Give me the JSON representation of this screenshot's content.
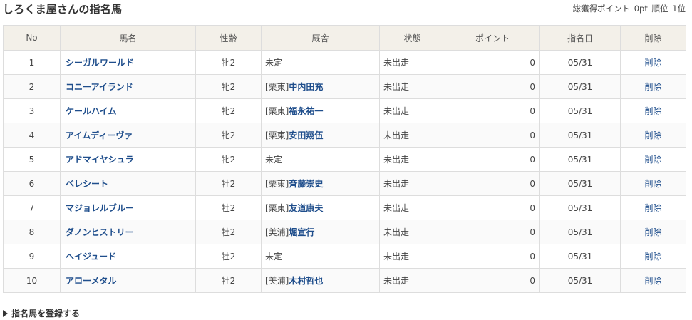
{
  "header": {
    "title": "しろくま屋さんの指名馬",
    "total_points_label": "総獲得ポイント",
    "total_points_value": "0pt",
    "rank_label": "順位",
    "rank_value": "1位"
  },
  "table": {
    "columns": [
      "No",
      "馬名",
      "性齢",
      "厩舎",
      "状態",
      "ポイント",
      "指名日",
      "削除"
    ],
    "rows": [
      {
        "no": "1",
        "name": "シーガルワールド",
        "sex_age": "牝2",
        "stable_prefix": "未定",
        "trainer": "",
        "status": "未出走",
        "points": "0",
        "date": "05/31",
        "delete": "削除"
      },
      {
        "no": "2",
        "name": "コニーアイランド",
        "sex_age": "牝2",
        "stable_prefix": "[栗東]",
        "trainer": "中内田充",
        "status": "未出走",
        "points": "0",
        "date": "05/31",
        "delete": "削除"
      },
      {
        "no": "3",
        "name": "ケールハイム",
        "sex_age": "牝2",
        "stable_prefix": "[栗東]",
        "trainer": "福永祐一",
        "status": "未出走",
        "points": "0",
        "date": "05/31",
        "delete": "削除"
      },
      {
        "no": "4",
        "name": "アイムディーヴァ",
        "sex_age": "牝2",
        "stable_prefix": "[栗東]",
        "trainer": "安田翔伍",
        "status": "未出走",
        "points": "0",
        "date": "05/31",
        "delete": "削除"
      },
      {
        "no": "5",
        "name": "アドマイヤシュラ",
        "sex_age": "牝2",
        "stable_prefix": "未定",
        "trainer": "",
        "status": "未出走",
        "points": "0",
        "date": "05/31",
        "delete": "削除"
      },
      {
        "no": "6",
        "name": "ベレシート",
        "sex_age": "牡2",
        "stable_prefix": "[栗東]",
        "trainer": "斉藤崇史",
        "status": "未出走",
        "points": "0",
        "date": "05/31",
        "delete": "削除"
      },
      {
        "no": "7",
        "name": "マジョレルブルー",
        "sex_age": "牡2",
        "stable_prefix": "[栗東]",
        "trainer": "友道康夫",
        "status": "未出走",
        "points": "0",
        "date": "05/31",
        "delete": "削除"
      },
      {
        "no": "8",
        "name": "ダノンヒストリー",
        "sex_age": "牡2",
        "stable_prefix": "[美浦]",
        "trainer": "堀宣行",
        "status": "未出走",
        "points": "0",
        "date": "05/31",
        "delete": "削除"
      },
      {
        "no": "9",
        "name": "ヘイジュード",
        "sex_age": "牡2",
        "stable_prefix": "未定",
        "trainer": "",
        "status": "未出走",
        "points": "0",
        "date": "05/31",
        "delete": "削除"
      },
      {
        "no": "10",
        "name": "アローメタル",
        "sex_age": "牡2",
        "stable_prefix": "[美浦]",
        "trainer": "木村哲也",
        "status": "未出走",
        "points": "0",
        "date": "05/31",
        "delete": "削除"
      }
    ]
  },
  "footer": {
    "register_label": "指名馬を登録する",
    "register_icon": "triangle-right-icon"
  },
  "colors": {
    "link": "#1f4e8c",
    "header_bg": "#f3f0e9",
    "border": "#dddddd"
  }
}
